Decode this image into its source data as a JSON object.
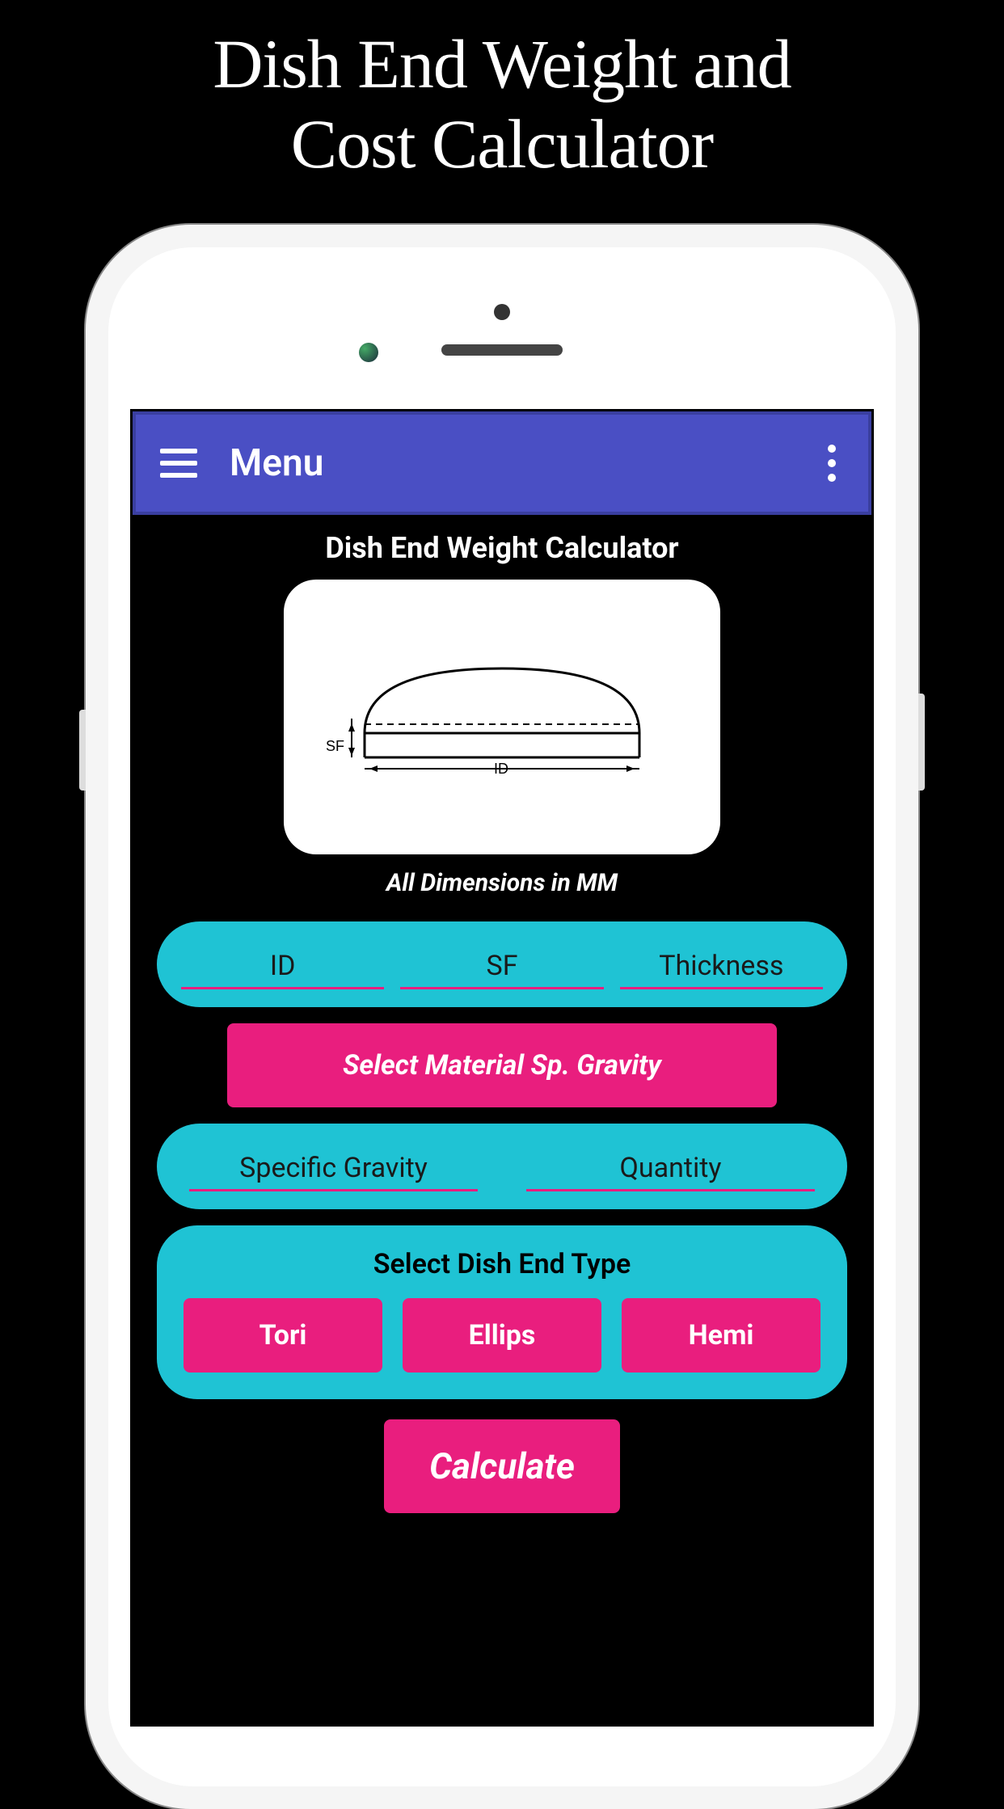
{
  "promo": {
    "title_line1": "Dish End Weight and",
    "title_line2": "Cost Calculator"
  },
  "appbar": {
    "menu_label": "Menu"
  },
  "content": {
    "title": "Dish End Weight Calculator",
    "diagram": {
      "sf_label": "SF",
      "id_label": "ID"
    },
    "dimensions_note": "All Dimensions in MM",
    "inputs_row1": {
      "id": "ID",
      "sf": "SF",
      "thickness": "Thickness"
    },
    "material_button": "Select Material Sp. Gravity",
    "inputs_row2": {
      "specific_gravity": "Specific Gravity",
      "quantity": "Quantity"
    },
    "type_section": {
      "title": "Select Dish End Type",
      "options": [
        "Tori",
        "Ellips",
        "Hemi"
      ]
    },
    "calculate_button": "Calculate"
  }
}
